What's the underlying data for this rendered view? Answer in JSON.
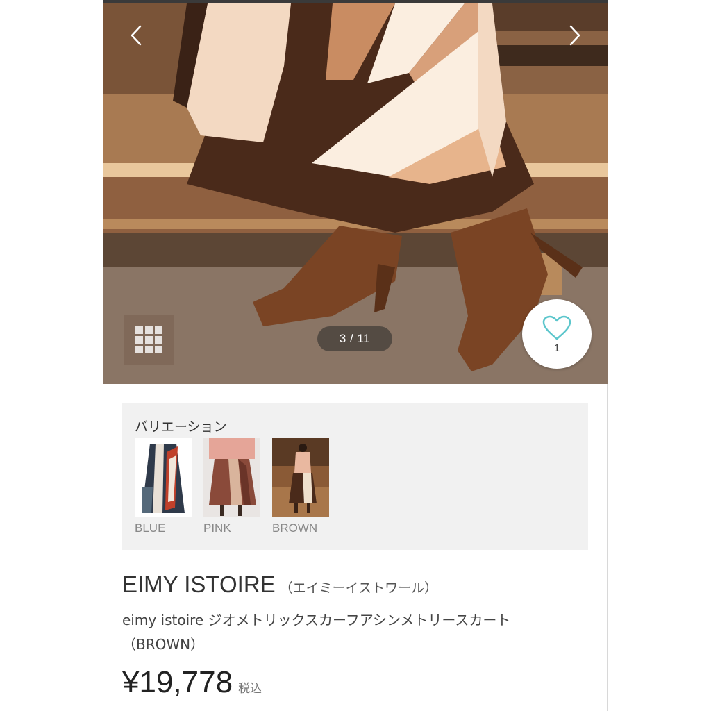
{
  "gallery": {
    "counter": "3 / 11",
    "favorite_count": "1"
  },
  "variation": {
    "title": "バリエーション",
    "items": [
      {
        "label": "BLUE"
      },
      {
        "label": "PINK"
      },
      {
        "label": "BROWN"
      }
    ]
  },
  "product": {
    "brand": "EIMY ISTOIRE",
    "brand_kana": "（エイミーイストワール）",
    "name": "eimy istoire ジオメトリックスカーフアシンメトリースカート（BROWN）",
    "price": "¥19,778",
    "tax_label": "税込"
  },
  "icons": {
    "prev": "chevron-left-icon",
    "next": "chevron-right-icon",
    "grid": "grid-icon",
    "favorite": "heart-icon"
  },
  "colors": {
    "heart": "#5cc6cc",
    "variation_bg": "#f1f1f1"
  }
}
